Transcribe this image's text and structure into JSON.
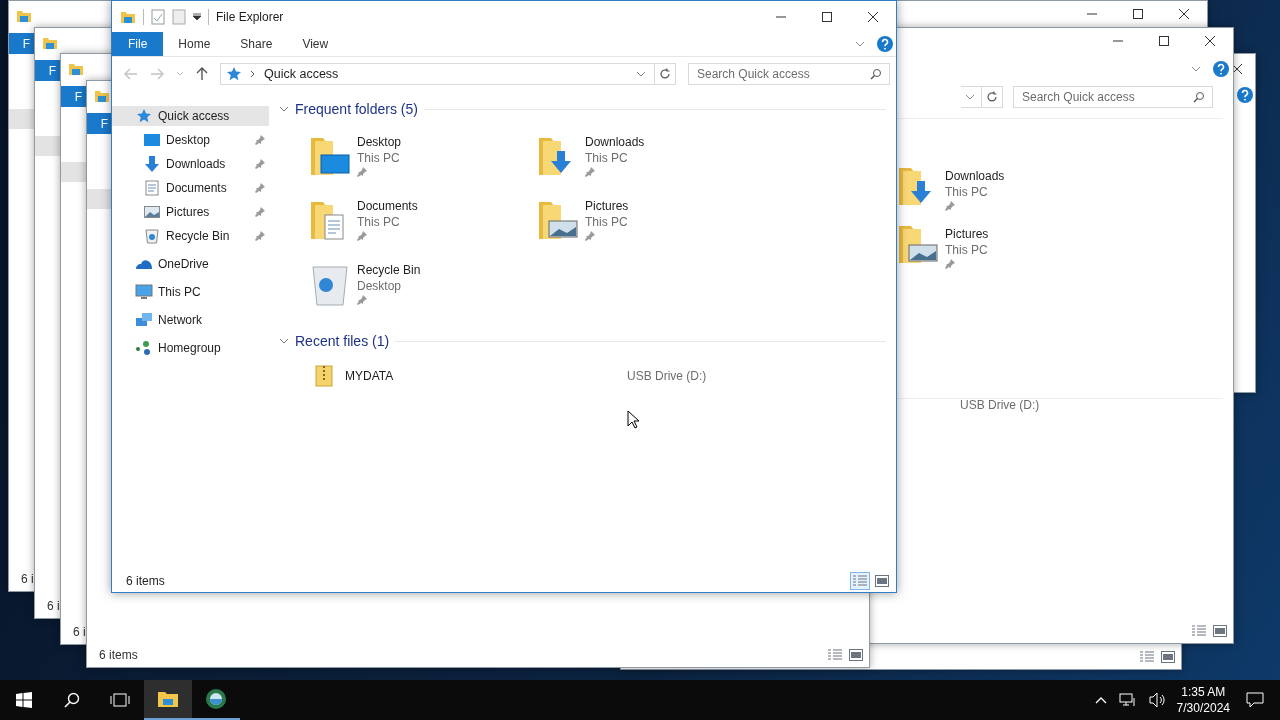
{
  "back_windows": [
    {
      "kind": "right",
      "close_button": true,
      "min_max_buttons": false,
      "help": true
    },
    {
      "kind": "right",
      "status_view_icons": true
    },
    {
      "kind": "right",
      "close_button": true,
      "min_max_buttons": true
    },
    {
      "kind": "right",
      "close_button": true,
      "min_max_buttons": true,
      "help": true,
      "search": {
        "placeholder": "Search Quick access"
      },
      "folders": [
        {
          "name": "Downloads",
          "location": "This PC",
          "pinned": true
        },
        {
          "name": "Pictures",
          "location": "This PC",
          "pinned": true
        }
      ],
      "recent_location": "USB Drive (D:)",
      "status_view_icons": true
    },
    {
      "kind": "left",
      "file_tab": "F",
      "status": "6 i"
    },
    {
      "kind": "left",
      "file_tab": "F",
      "status": "6 i"
    },
    {
      "kind": "left",
      "file_tab": "F",
      "status": "6 i"
    },
    {
      "kind": "left",
      "file_tab": "F",
      "status": "6 items",
      "status_view_icons": true
    }
  ],
  "window": {
    "title": "File Explorer"
  },
  "ribbon_tabs": [
    {
      "label": "File",
      "selected": true
    },
    {
      "label": "Home",
      "selected": false
    },
    {
      "label": "Share",
      "selected": false
    },
    {
      "label": "View",
      "selected": false
    }
  ],
  "address": {
    "location": "Quick access"
  },
  "search": {
    "placeholder": "Search Quick access"
  },
  "nav": [
    {
      "label": "Quick access",
      "selected": true,
      "children": [
        {
          "label": "Desktop",
          "selected": false,
          "pinned": true
        },
        {
          "label": "Downloads",
          "selected": false,
          "pinned": true
        },
        {
          "label": "Documents",
          "selected": false,
          "pinned": true
        },
        {
          "label": "Pictures",
          "selected": false,
          "pinned": true
        },
        {
          "label": "Recycle Bin",
          "selected": false,
          "pinned": true
        }
      ]
    },
    {
      "label": "OneDrive",
      "selected": false
    },
    {
      "label": "This PC",
      "selected": false
    },
    {
      "label": "Network",
      "selected": false
    },
    {
      "label": "Homegroup",
      "selected": false
    }
  ],
  "sections": [
    {
      "title": "Frequent folders (5)",
      "expanded": true,
      "kind": "tiles",
      "items": [
        {
          "name": "Desktop",
          "location": "This PC",
          "pinned": true
        },
        {
          "name": "Downloads",
          "location": "This PC",
          "pinned": true
        },
        {
          "name": "Documents",
          "location": "This PC",
          "pinned": true
        },
        {
          "name": "Pictures",
          "location": "This PC",
          "pinned": true
        },
        {
          "name": "Recycle Bin",
          "location": "Desktop",
          "pinned": true
        }
      ]
    },
    {
      "title": "Recent files (1)",
      "expanded": true,
      "kind": "list",
      "items": [
        {
          "name": "MYDATA",
          "location": "USB Drive (D:)"
        }
      ]
    }
  ],
  "status_bar": {
    "text": "6 items",
    "views": [
      {
        "selected": true
      },
      {
        "selected": false
      }
    ]
  },
  "taskbar": {
    "apps": [
      {
        "selected": true
      },
      {
        "selected": false
      }
    ],
    "clock": {
      "time": "1:35 AM",
      "date": "7/30/2024"
    }
  }
}
